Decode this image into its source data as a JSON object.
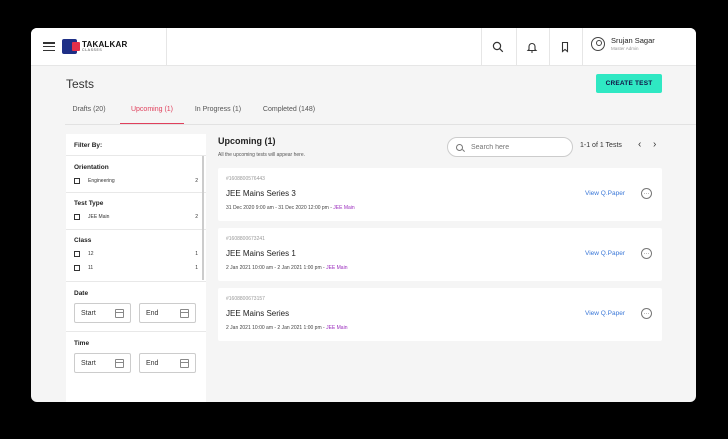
{
  "brand": {
    "name": "TAKALKAR",
    "tagline": "CLASSES"
  },
  "user": {
    "name": "Srujan Sagar",
    "role": "Master Admin"
  },
  "page": {
    "title": "Tests",
    "create_label": "CREATE TEST"
  },
  "tabs": [
    {
      "label": "Drafts (20)"
    },
    {
      "label": "Upcoming (1)"
    },
    {
      "label": "In Progress (1)"
    },
    {
      "label": "Completed (148)"
    }
  ],
  "filters": {
    "heading": "Filter By:",
    "orientation": {
      "title": "Orientation",
      "options": [
        {
          "label": "Engineering",
          "count": "2"
        }
      ]
    },
    "test_type": {
      "title": "Test Type",
      "options": [
        {
          "label": "JEE Main",
          "count": "2"
        }
      ]
    },
    "class": {
      "title": "Class",
      "options": [
        {
          "label": "12",
          "count": "1"
        },
        {
          "label": "11",
          "count": "1"
        }
      ]
    },
    "date": {
      "title": "Date",
      "start": "Start",
      "end": "End"
    },
    "time": {
      "title": "Time",
      "start": "Start",
      "end": "End"
    }
  },
  "list": {
    "title": "Upcoming (1)",
    "subtitle": "All the upcoming tests will appear here.",
    "search_placeholder": "Search here",
    "pagination": "1-1 of 1 Tests"
  },
  "tests": [
    {
      "id": "#1608800576443",
      "name": "JEE Mains Series 3",
      "schedule": "31 Dec 2020 9:00 am - 31 Dec 2020 12:00 pm - ",
      "tag": "JEE Main",
      "link": "View Q.Paper"
    },
    {
      "id": "#1608800673241",
      "name": "JEE Mains Series 1",
      "schedule": "2 Jan 2021 10:00 am - 2 Jan 2021 1:00 pm - ",
      "tag": "JEE Main",
      "link": "View Q.Paper"
    },
    {
      "id": "#1608800673157",
      "name": "JEE Mains Series",
      "schedule": "2 Jan 2021 10:00 am - 2 Jan 2021 1:00 pm - ",
      "tag": "JEE Main",
      "link": "View Q.Paper"
    }
  ],
  "colors": {
    "accent": "#e0405c",
    "create": "#2fe8c3",
    "link": "#3b78d8",
    "tag": "#9b2dbe"
  }
}
